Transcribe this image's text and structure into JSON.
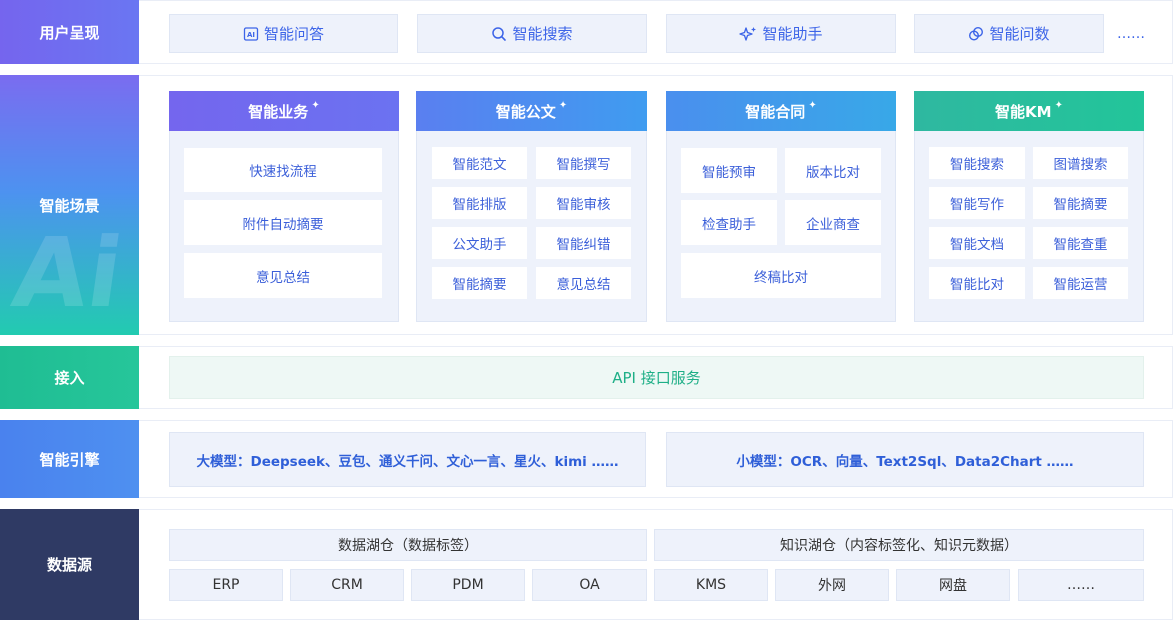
{
  "rows": {
    "presentation": {
      "label": "用户呈现",
      "items": [
        {
          "label": "智能问答",
          "icon": "ai-text-icon"
        },
        {
          "label": "智能搜索",
          "icon": "search-icon"
        },
        {
          "label": "智能助手",
          "icon": "sparkle-icon"
        },
        {
          "label": "智能问数",
          "icon": "chart-link-icon"
        }
      ],
      "more": "……"
    },
    "scenes": {
      "label": "智能场景",
      "watermark": "Ai",
      "columns": [
        {
          "title": "智能业务",
          "items": [
            "快速找流程",
            "附件自动摘要",
            "意见总结"
          ]
        },
        {
          "title": "智能公文",
          "items": [
            "智能范文",
            "智能撰写",
            "智能排版",
            "智能审核",
            "公文助手",
            "智能纠错",
            "智能摘要",
            "意见总结"
          ]
        },
        {
          "title": "智能合同",
          "items": [
            "智能预审",
            "版本比对",
            "检查助手",
            "企业商查",
            "终稿比对"
          ]
        },
        {
          "title": "智能KM",
          "items": [
            "智能搜索",
            "图谱搜索",
            "智能写作",
            "智能摘要",
            "智能文档",
            "智能查重",
            "智能比对",
            "智能运营"
          ]
        }
      ]
    },
    "access": {
      "label": "接入",
      "service": "API 接口服务"
    },
    "engine": {
      "label": "智能引擎",
      "large": "大模型：Deepseek、豆包、通义千问、文心一言、星火、kimi ……",
      "small": "小模型：OCR、向量、Text2Sql、Data2Chart ……"
    },
    "datasource": {
      "label": "数据源",
      "lakes": [
        "数据湖仓（数据标签）",
        "知识湖仓（内容标签化、知识元数据）"
      ],
      "sources": [
        "ERP",
        "CRM",
        "PDM",
        "OA",
        "KMS",
        "外网",
        "网盘",
        "……"
      ]
    }
  },
  "colors": {
    "presentation": "#6f63ea",
    "scenes_top": "#7a6cf0",
    "scenes_bottom": "#22cbb0",
    "access": "#22c094",
    "engine": "#4a87ee",
    "datasource": "#2f3a64",
    "text_blue": "#3c64e8"
  }
}
